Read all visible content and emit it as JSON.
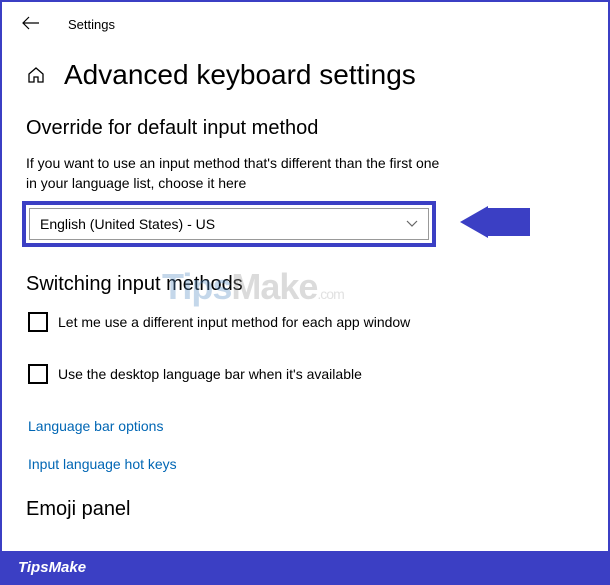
{
  "header": {
    "settings_label": "Settings",
    "page_title": "Advanced keyboard settings"
  },
  "override_section": {
    "heading": "Override for default input method",
    "description": "If you want to use an input method that's different than the first one in your language list, choose it here",
    "dropdown_value": "English (United States) - US"
  },
  "switching_section": {
    "heading": "Switching input methods",
    "checkbox1_label": "Let me use a different input method for each app window",
    "checkbox2_label": "Use the desktop language bar when it's available",
    "link1": "Language bar options",
    "link2": "Input language hot keys"
  },
  "emoji_section": {
    "heading": "Emoji panel"
  },
  "watermark": {
    "tips": "Tips",
    "make": "Make",
    "com": ".com"
  },
  "footer": {
    "text": "TipsMake"
  }
}
